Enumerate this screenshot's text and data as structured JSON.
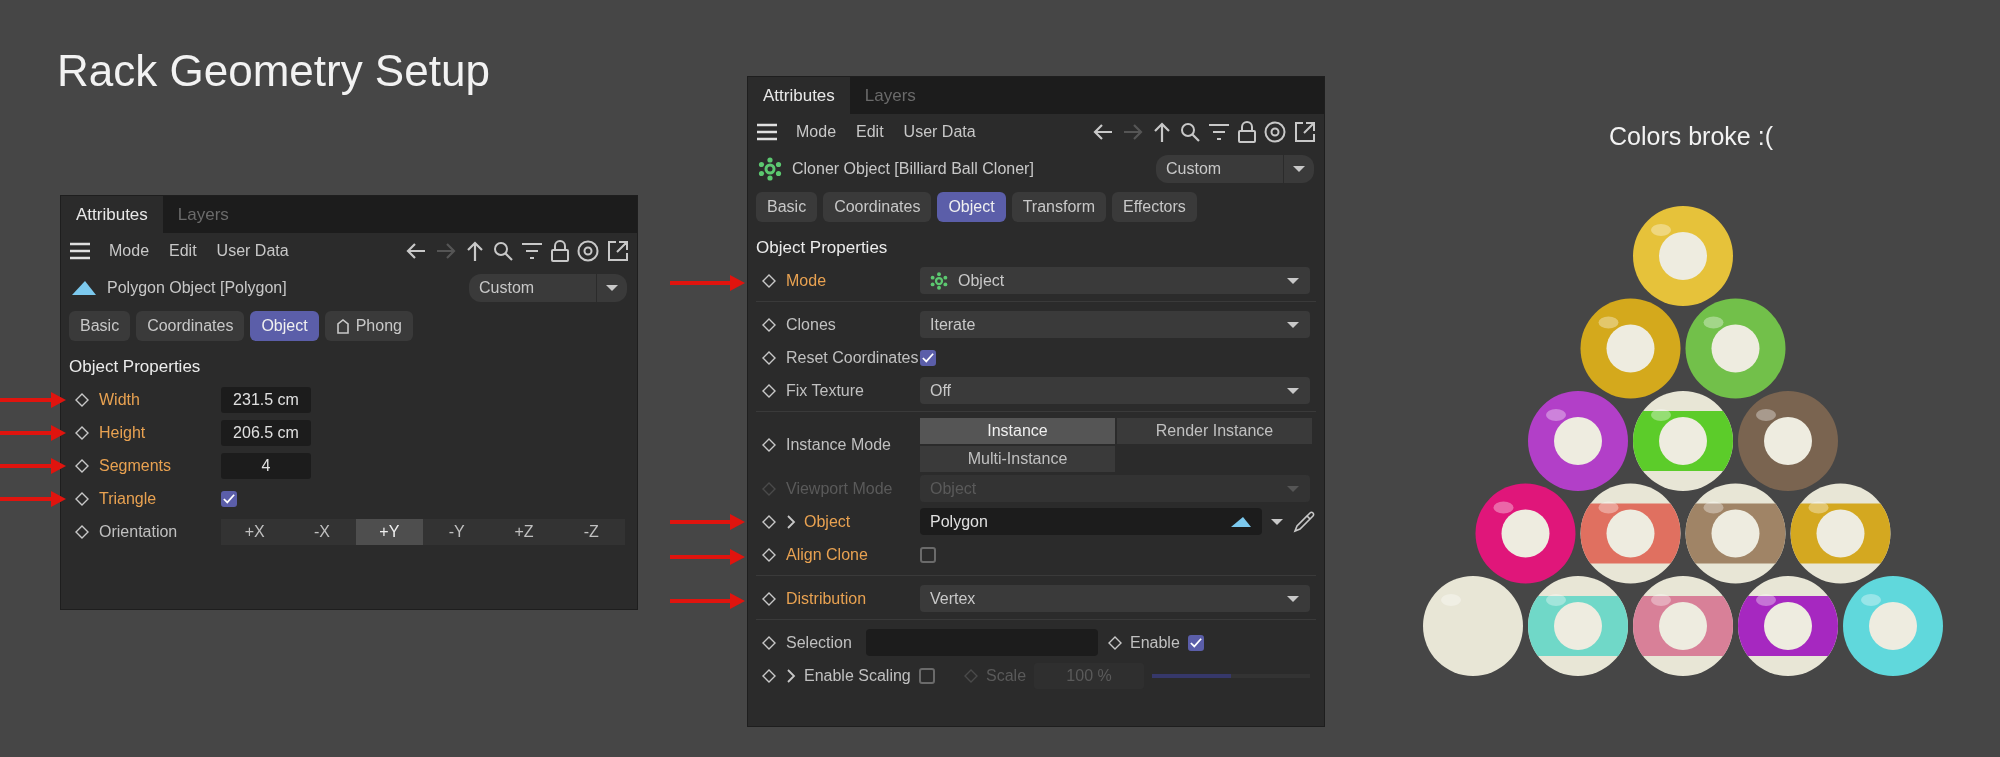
{
  "title": "Rack Geometry Setup",
  "panels": [
    {
      "tabs": [
        {
          "label": "Attributes",
          "selected": true
        },
        {
          "label": "Layers",
          "selected": false
        }
      ],
      "menu": [
        "Mode",
        "Edit",
        "User Data"
      ],
      "object": {
        "kind": "polygon",
        "name": "Polygon Object [Polygon]",
        "preset": "Custom"
      },
      "sections": [
        {
          "label": "Basic",
          "selected": false,
          "tag_icon": false
        },
        {
          "label": "Coordinates",
          "selected": false,
          "tag_icon": false
        },
        {
          "label": "Object",
          "selected": true,
          "tag_icon": false
        },
        {
          "label": "Phong",
          "selected": false,
          "tag_icon": true
        }
      ],
      "heading": "Object Properties",
      "rows": [
        {
          "kind": "number",
          "label": "Width",
          "value": "231.5 cm",
          "marked": true,
          "disabled": false,
          "divider": false
        },
        {
          "kind": "number",
          "label": "Height",
          "value": "206.5 cm",
          "marked": true,
          "disabled": false,
          "divider": false
        },
        {
          "kind": "number",
          "label": "Segments",
          "value": "4",
          "marked": true,
          "disabled": false,
          "divider": false
        },
        {
          "kind": "checkbox",
          "label": "Triangle",
          "checked": true,
          "marked": true,
          "disabled": false,
          "divider": false
        },
        {
          "kind": "segmented",
          "label": "Orientation",
          "marked": false,
          "disabled": false,
          "divider": false,
          "options": [
            {
              "label": "+X",
              "selected": false
            },
            {
              "label": "-X",
              "selected": false
            },
            {
              "label": "+Y",
              "selected": true
            },
            {
              "label": "-Y",
              "selected": false
            },
            {
              "label": "+Z",
              "selected": false
            },
            {
              "label": "-Z",
              "selected": false
            }
          ]
        }
      ]
    },
    {
      "tabs": [
        {
          "label": "Attributes",
          "selected": true
        },
        {
          "label": "Layers",
          "selected": false
        }
      ],
      "menu": [
        "Mode",
        "Edit",
        "User Data"
      ],
      "object": {
        "kind": "cloner",
        "name": "Cloner Object [Billiard Ball Cloner]",
        "preset": "Custom"
      },
      "sections": [
        {
          "label": "Basic",
          "selected": false,
          "tag_icon": false
        },
        {
          "label": "Coordinates",
          "selected": false,
          "tag_icon": false
        },
        {
          "label": "Object",
          "selected": true,
          "tag_icon": false
        },
        {
          "label": "Transform",
          "selected": false,
          "tag_icon": false
        },
        {
          "label": "Effectors",
          "selected": false,
          "tag_icon": false
        }
      ],
      "heading": "Object Properties",
      "rows": [
        {
          "kind": "dropdown",
          "label": "Mode",
          "value": "Object",
          "value_icon": true,
          "marked": true,
          "disabled": false,
          "divider": true
        },
        {
          "kind": "dropdown",
          "label": "Clones",
          "value": "Iterate",
          "value_icon": false,
          "marked": false,
          "disabled": false,
          "divider": false
        },
        {
          "kind": "checkbox",
          "label": "Reset Coordinates",
          "checked": true,
          "marked": false,
          "disabled": false,
          "divider": false
        },
        {
          "kind": "dropdown",
          "label": "Fix Texture",
          "value": "Off",
          "value_icon": false,
          "marked": false,
          "disabled": false,
          "divider": true
        },
        {
          "kind": "segmented",
          "label": "Instance Mode",
          "marked": false,
          "disabled": false,
          "divider": false,
          "options": [
            {
              "label": "Instance",
              "selected": true
            },
            {
              "label": "Render Instance",
              "selected": false
            },
            {
              "label": "Multi-Instance",
              "selected": false
            }
          ]
        },
        {
          "kind": "dropdown",
          "label": "Viewport Mode",
          "value": "Object",
          "value_icon": false,
          "marked": false,
          "disabled": true,
          "divider": false
        },
        {
          "kind": "link",
          "label": "Object",
          "value": "Polygon",
          "marked": true,
          "disabled": false,
          "divider": false
        },
        {
          "kind": "checkbox",
          "label": "Align Clone",
          "checked": false,
          "marked": true,
          "disabled": false,
          "divider": true
        },
        {
          "kind": "dropdown",
          "label": "Distribution",
          "value": "Vertex",
          "value_icon": false,
          "marked": true,
          "disabled": false,
          "divider": true
        },
        {
          "kind": "selection",
          "label": "Selection",
          "enable_label": "Enable",
          "enable_checked": true,
          "marked": false,
          "disabled": false,
          "divider": false
        },
        {
          "kind": "scaling",
          "label": "Enable Scaling",
          "checked": false,
          "scale_label": "Scale",
          "scale_value": "100 %",
          "level": 0.5,
          "marked": false,
          "disabled": false,
          "divider": false
        }
      ]
    }
  ],
  "render": {
    "caption": "Colors broke :("
  }
}
